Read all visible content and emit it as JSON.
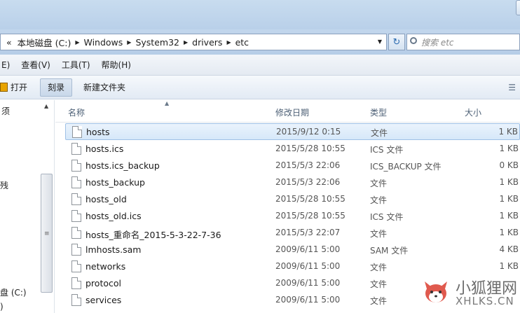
{
  "address": {
    "overflow": "«",
    "crumbs": [
      "本地磁盘 (C:)",
      "Windows",
      "System32",
      "drivers",
      "etc"
    ]
  },
  "search": {
    "placeholder": "搜索 etc"
  },
  "menu": {
    "items": [
      "E)",
      "查看(V)",
      "工具(T)",
      "帮助(H)"
    ]
  },
  "toolbar": {
    "open": "打开",
    "burn": "刻录",
    "new_folder": "新建文件夹"
  },
  "nav": {
    "labels": [
      "须",
      "残",
      "盘 (C:)",
      ")"
    ]
  },
  "columns": {
    "name": "名称",
    "date": "修改日期",
    "type": "类型",
    "size": "大小"
  },
  "files": [
    {
      "name": "hosts",
      "date": "2015/9/12 0:15",
      "type": "文件",
      "size": "1 KB",
      "selected": true
    },
    {
      "name": "hosts.ics",
      "date": "2015/5/28 10:55",
      "type": "ICS 文件",
      "size": "1 KB"
    },
    {
      "name": "hosts.ics_backup",
      "date": "2015/5/3 22:06",
      "type": "ICS_BACKUP 文件",
      "size": "0 KB"
    },
    {
      "name": "hosts_backup",
      "date": "2015/5/3 22:06",
      "type": "文件",
      "size": "1 KB"
    },
    {
      "name": "hosts_old",
      "date": "2015/5/28 10:55",
      "type": "文件",
      "size": "1 KB"
    },
    {
      "name": "hosts_old.ics",
      "date": "2015/5/28 10:55",
      "type": "ICS 文件",
      "size": "1 KB"
    },
    {
      "name": "hosts_重命名_2015-5-3-22-7-36",
      "date": "2015/5/3 22:07",
      "type": "文件",
      "size": "1 KB"
    },
    {
      "name": "lmhosts.sam",
      "date": "2009/6/11 5:00",
      "type": "SAM 文件",
      "size": "4 KB"
    },
    {
      "name": "networks",
      "date": "2009/6/11 5:00",
      "type": "文件",
      "size": "1 KB"
    },
    {
      "name": "protocol",
      "date": "2009/6/11 5:00",
      "type": "文件",
      "size": ""
    },
    {
      "name": "services",
      "date": "2009/6/11 5:00",
      "type": "文件",
      "size": ""
    }
  ],
  "watermark": {
    "cn": "小狐狸网",
    "en": "XHLKS.CN"
  },
  "colors": {
    "selection": "#d6e8f9",
    "chrome": "#b9d0e9",
    "watermark_logo": "#e05a4e"
  }
}
